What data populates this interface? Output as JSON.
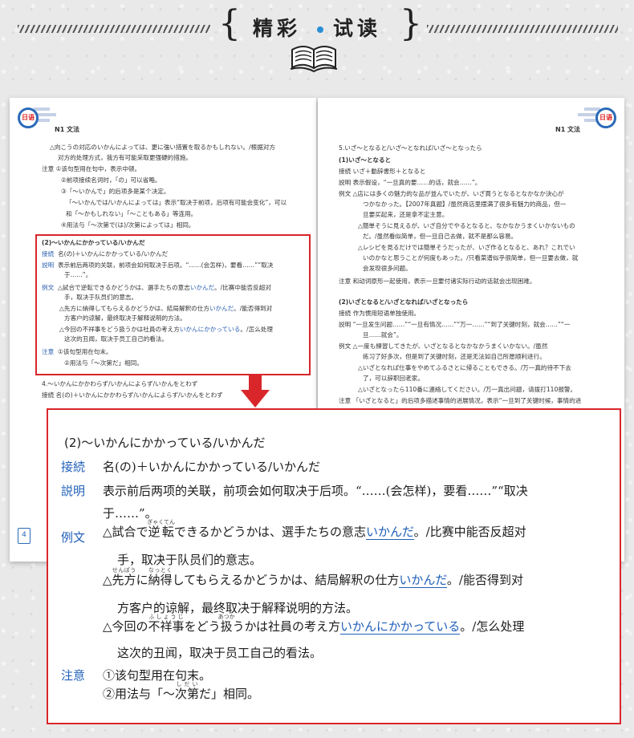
{
  "header": {
    "title_left": "精彩",
    "title_right": "试读",
    "brace_left": "{",
    "brace_right": "}",
    "icon": "open-book-icon"
  },
  "left_page": {
    "running_head": "N1 文法",
    "logo_text": "日语",
    "page_number": "4",
    "lines": [
      "△向こうの対応のいかんによっては、更に強い措置を取るかもしれない。/根据对方",
      "对方的处理方式，我方有可能采取更强硬的措施。",
      "注意 ①该句型用在句中，表示中顿。",
      "②前项接续名词时，「の」可以省略。",
      "③「～いかんで」的后项多是某个决定。",
      "「～いかんでは/いかんによっては」表示“取决于前项，后项有可能会变化”，可以",
      "和「～かもしれない」「～こともある」等连用。",
      "④用法与「～次第で(は)/次第によっては」相同。"
    ],
    "section4_title": "4.～いかんにかかわらず/いかんによらず/いかんをとわず",
    "section4_line": "接続 名(の)＋いかんにかかわらず/いかんによらず/いかんをとわず"
  },
  "right_page": {
    "running_head": "N1 文法",
    "logo_text": "日语",
    "section5_title": "5.いざ～となると/いざ～となれば/いざ～となったら",
    "sub1": "(1)いざ～となると",
    "sub1_lines": [
      "接続 いざ＋動辞書形＋となると",
      "説明 表示假设，“一旦真的要……的话，就会……”。",
      "例文 △店には多くの魅力的な品が並んでいたが、いざ買うとなるとなかなか決心が",
      "つかなかった。【2007年真题】/虽然商店里摆满了很多有魅力的商品，但一",
      "旦要买起来，还是拿不定主意。",
      "△簡単そうに見えるが、いざ自分でやるとなると、なかなかうまくいかないもの",
      "だ。/虽然看似简单，但一旦自己去做，就不是那么容易。",
      "△レシピを見るだけでは簡単そうだったが、いざ作るとなると、あれ？これでい",
      "いのかなと思うことが何度もあった。/只看菜谱似乎很简单，但一旦要去做，就",
      "会发现很多问题。",
      "注意 和动词原形一起使用，表示一旦要付诸实际行动的话就会出现困难。"
    ],
    "sub2": "(2)いざとなると/いざとなれば/いざとなったら",
    "sub2_lines": [
      "接続 作为惯用短语单独使用。",
      "説明 “一旦发生问题……”“一旦有情况……”“万一……”“到了关键时刻，就会……”“一",
      "旦……就会”。",
      "例文 △一度も練習してきたが、いざとなるとなかなかうまくいかない。/虽然",
      "练习了好多次，但是到了关键时刻，还是无法如自己所愿顺利进行。",
      "△いざとなれば仕事をやめてふるさとに帰ることもできる。/万一真的待不下去",
      "了，可以辞职回老家。",
      "△いざとなったら110番に連絡してください。/万一真出问题，请拨打110报警。",
      "注意 「いざとなると」的后项多描述事情的进展情况，表示“一旦到了关键时候，事情的进"
    ]
  },
  "panel": {
    "heading_num": "(2)",
    "heading": "～いかんにかかっている/いかんだ",
    "label_setsuzoku": "接続",
    "setsuzoku": "名(の)＋いかんにかかっている/いかんだ",
    "label_setsumei": "説明",
    "setsumei_1": "表示前后两项的关联，前项会如何取决于后项。“……(会怎样)，要看……”“取决",
    "setsumei_2": "于……”。",
    "label_reibun": "例文",
    "ex1_pre": "△試合で",
    "ex1_ruby_base": "逆転",
    "ex1_ruby_rt": "ぎゃくてん",
    "ex1_mid": "できるかどうかは、選手たちの意志",
    "ex1_hl": "いかんだ",
    "ex1_tr": "。/比赛中能否反超对",
    "ex1_tr2": "手，取决于队员们的意志。",
    "ex2_pre": "△",
    "ex2_r1_base": "先方",
    "ex2_r1_rt": "せんぽう",
    "ex2_mid1": "に",
    "ex2_r2_base": "納得",
    "ex2_r2_rt": "なっとく",
    "ex2_mid2": "してもらえるかどうかは、結局解釈の仕方",
    "ex2_hl": "いかんだ",
    "ex2_tr": "。/能否得到对",
    "ex2_tr2": "方客户的谅解，最终取决于解释说明的方法。",
    "ex3_pre": "△今回の",
    "ex3_r1_base": "不祥事",
    "ex3_r1_rt": "ふしょうじ",
    "ex3_mid1": "をどう",
    "ex3_r2_base": "扱",
    "ex3_r2_rt": "あつか",
    "ex3_mid2": "うかは社員の考え方",
    "ex3_hl": "いかんにかかっている",
    "ex3_tr": "。/怎么处理",
    "ex3_tr2": "这次的丑闻，取决于员工自己的看法。",
    "label_chui": "注意",
    "chui_1": "①该句型用在句末。",
    "chui_2_pre": "②用法与「～",
    "chui_2_ruby_base": "次第",
    "chui_2_ruby_rt": "しだい",
    "chui_2_post": "だ」相同。"
  },
  "colors": {
    "accent_blue": "#1f5fb8",
    "frame_red": "#d9262b"
  }
}
